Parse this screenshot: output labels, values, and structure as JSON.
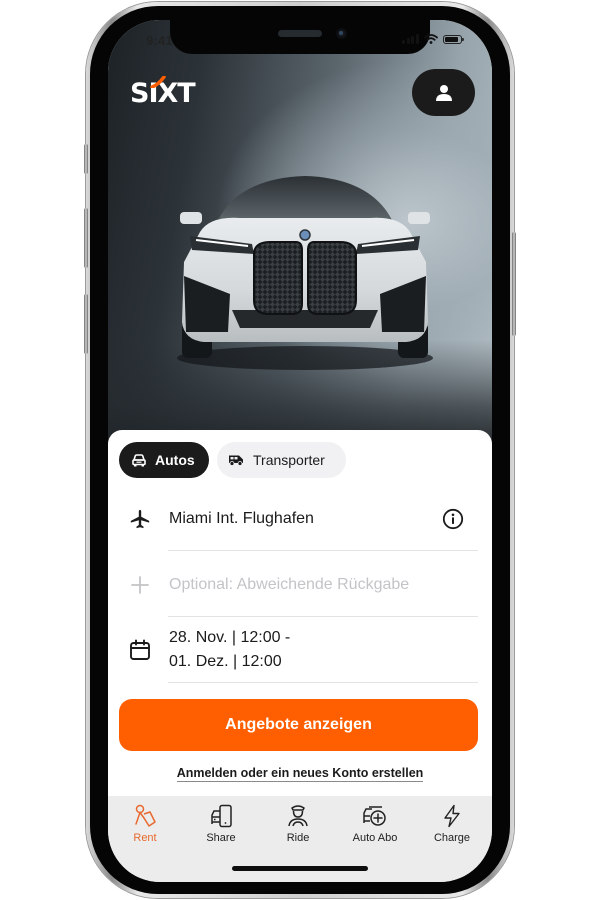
{
  "status_bar": {
    "time": "9:41"
  },
  "header": {
    "logo_text": "SIXT",
    "profile_button": "profile-icon"
  },
  "hero": {
    "image": "white BMW iX electric SUV front view"
  },
  "vehicle_type": {
    "options": [
      {
        "label": "Autos",
        "icon": "car-icon",
        "selected": true
      },
      {
        "label": "Transporter",
        "icon": "van-icon",
        "selected": false
      }
    ]
  },
  "booking": {
    "pickup": {
      "icon": "airplane-icon",
      "value": "Miami Int. Flughafen",
      "info_icon": "info-icon"
    },
    "return": {
      "icon": "plus-icon",
      "placeholder": "Optional: Abweichende Rückgabe"
    },
    "dates": {
      "icon": "calendar-icon",
      "line1": "28. Nov. | 12:00 -",
      "line2": "01. Dez. | 12:00"
    },
    "cta_label": "Angebote anzeigen",
    "login_link": "Anmelden oder ein neues Konto erstellen"
  },
  "tabbar": {
    "items": [
      {
        "label": "Rent",
        "icon": "key-tag-icon",
        "active": true
      },
      {
        "label": "Share",
        "icon": "car-phone-icon",
        "active": false
      },
      {
        "label": "Ride",
        "icon": "chauffeur-icon",
        "active": false
      },
      {
        "label": "Auto Abo",
        "icon": "car-subscription-icon",
        "active": false
      },
      {
        "label": "Charge",
        "icon": "lightning-icon",
        "active": false
      }
    ]
  },
  "colors": {
    "brand_orange": "#ff5f00",
    "active_tab": "#e8692f",
    "dark": "#1b1b1b",
    "placeholder": "#c4c4c8"
  }
}
